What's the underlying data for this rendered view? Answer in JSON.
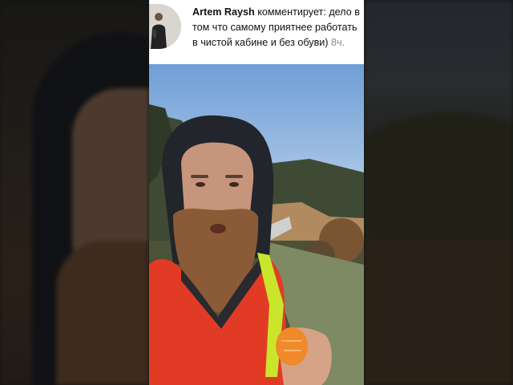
{
  "comment": {
    "author": "Artem Raysh",
    "verb": "комментирует:",
    "text": "дело в том что самому приятнее работать в чистой кабине и без обуви)",
    "time": "8ч."
  },
  "colors": {
    "jacket": "#e23b25",
    "safety_vest": "#c9e62a",
    "sky": "#86aee0"
  },
  "icons": [
    "avatar-photo"
  ]
}
